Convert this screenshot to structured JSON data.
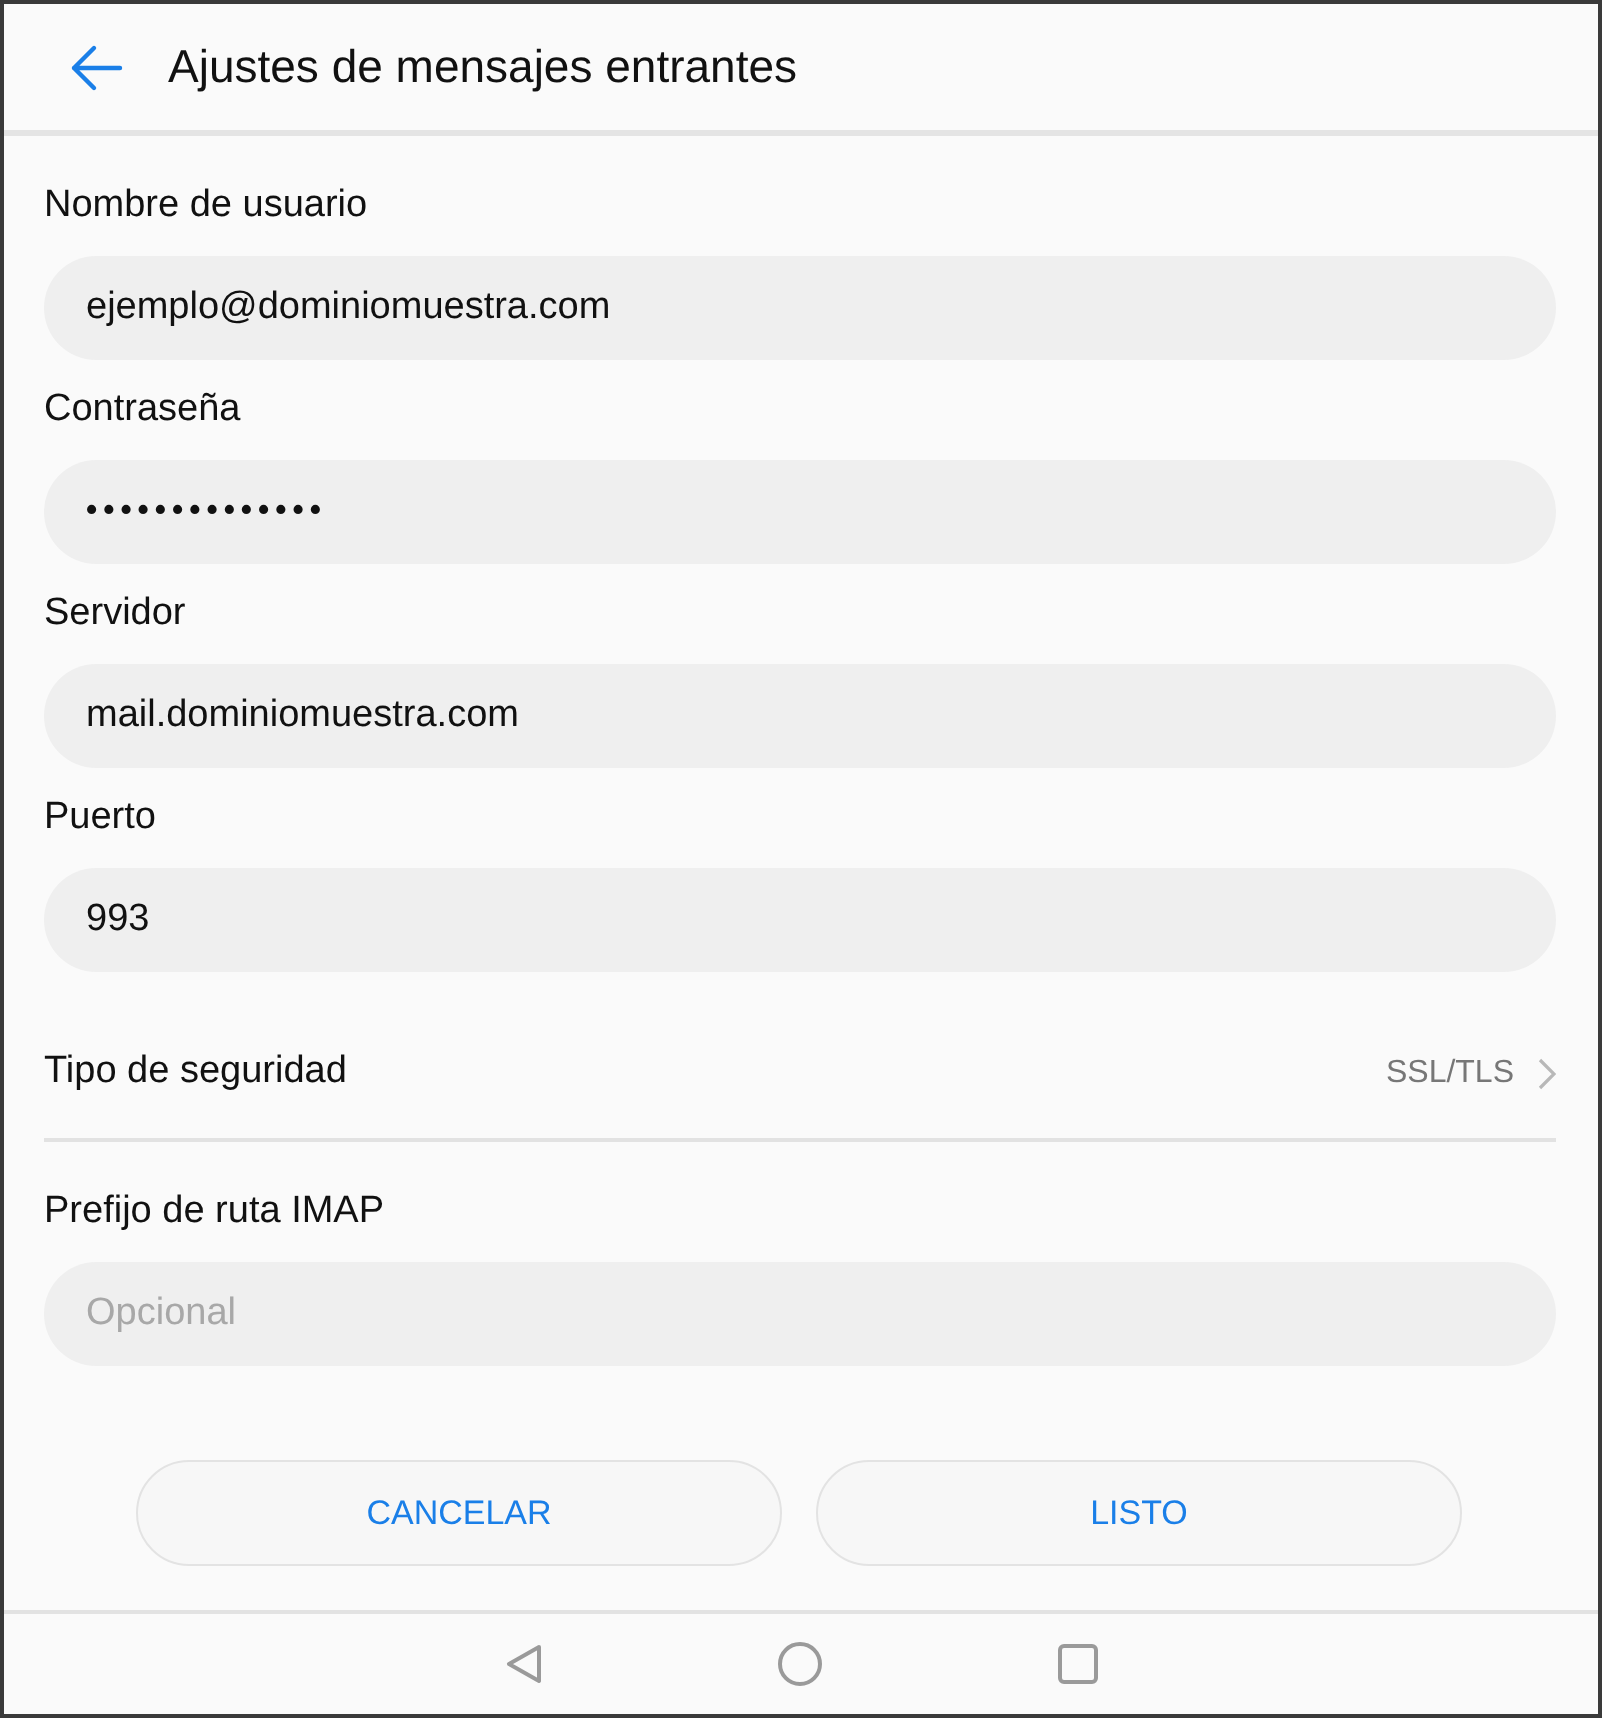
{
  "header": {
    "title": "Ajustes de mensajes entrantes"
  },
  "form": [
    {
      "kind": "text",
      "label": "Nombre de usuario",
      "value": "ejemplo@dominiomuestra.com"
    },
    {
      "kind": "password",
      "label": "Contraseña",
      "value": "••••••••••••••"
    },
    {
      "kind": "text",
      "label": "Servidor",
      "value": "mail.dominiomuestra.com"
    },
    {
      "kind": "text",
      "label": "Puerto",
      "value": "993"
    },
    {
      "kind": "select",
      "label": "Tipo de seguridad",
      "value": "SSL/TLS"
    },
    {
      "kind": "text",
      "label": "Prefijo de ruta IMAP",
      "placeholder": "Opcional"
    }
  ],
  "buttons": [
    "CANCELAR",
    "LISTO"
  ]
}
